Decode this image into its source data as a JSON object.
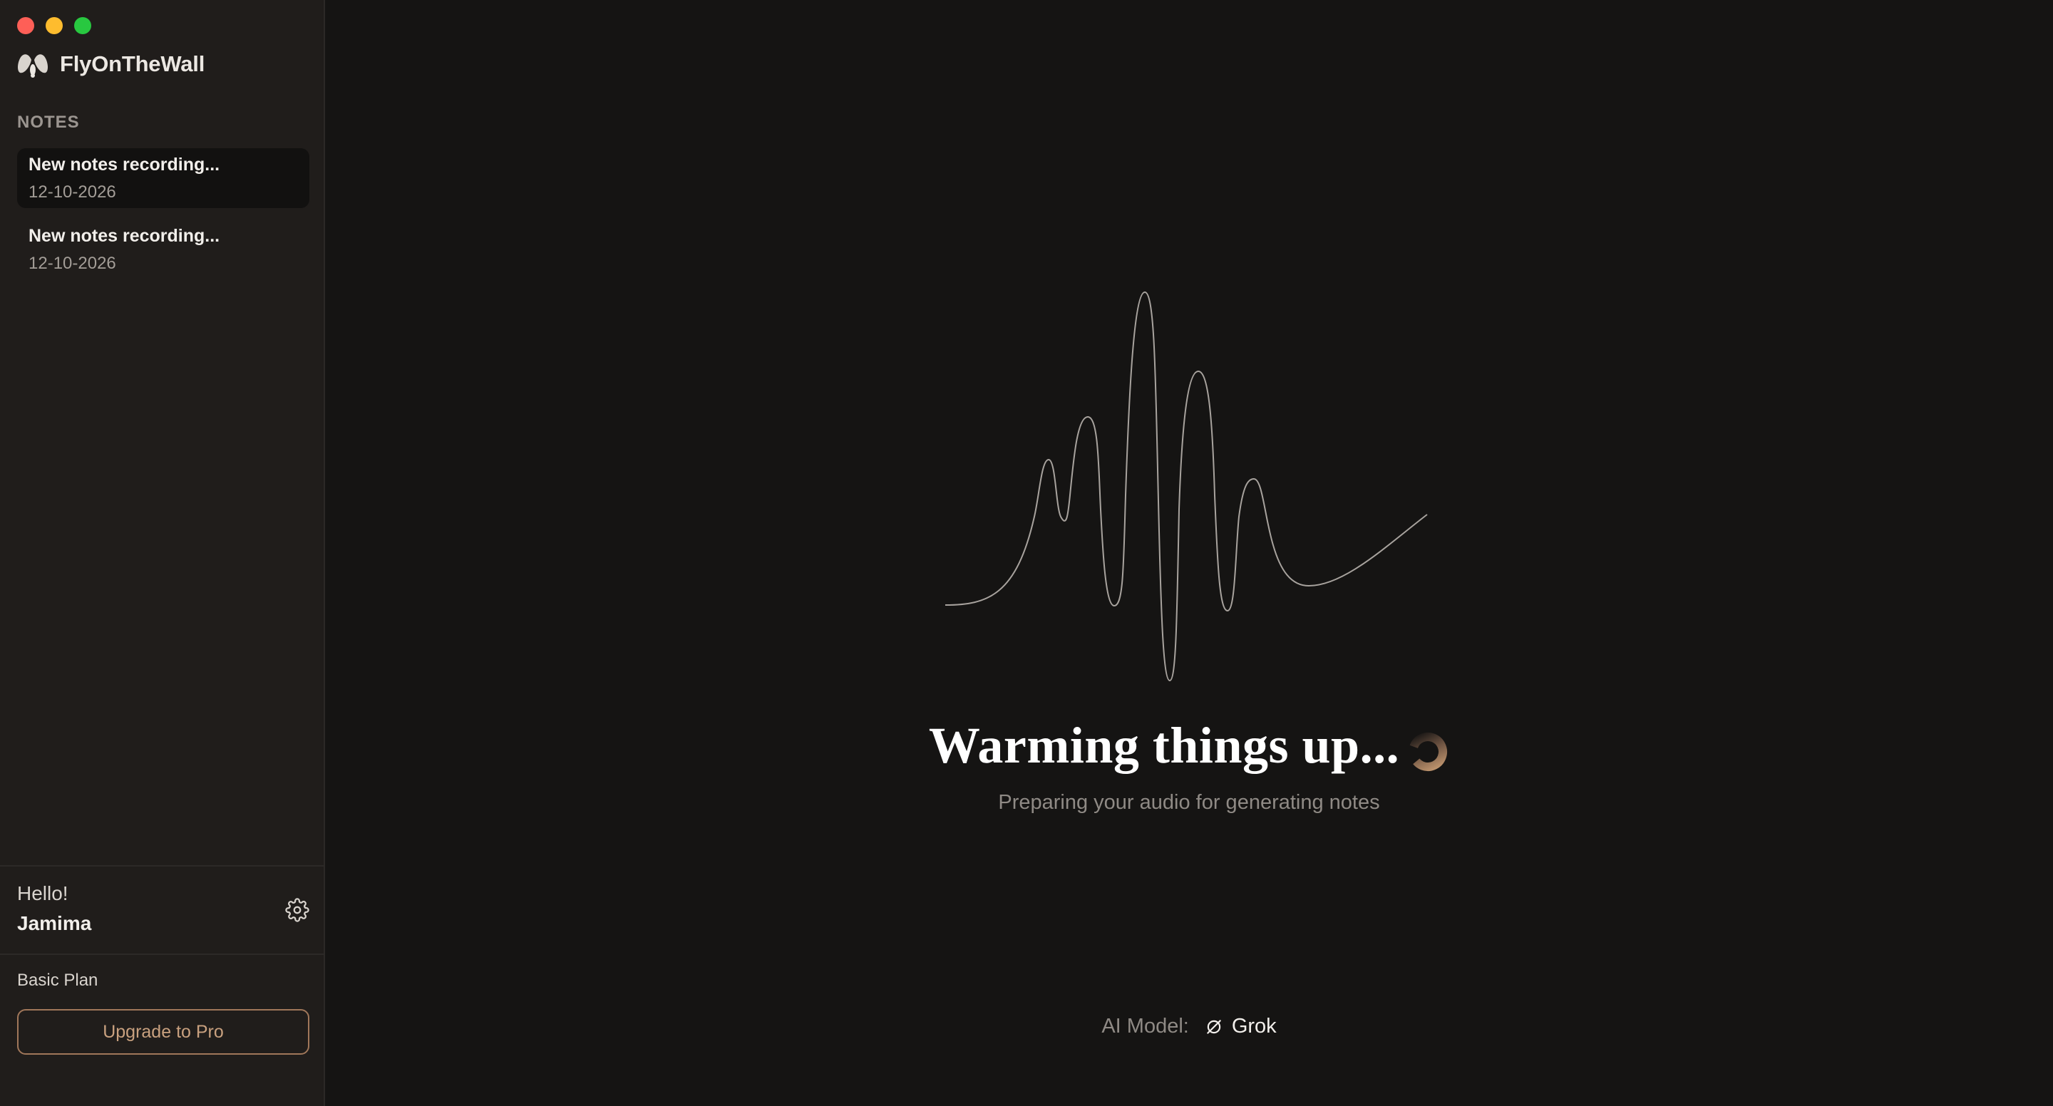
{
  "app": {
    "name": "FlyOnTheWall"
  },
  "window_controls": [
    {
      "name": "close-button"
    },
    {
      "name": "minimize-button"
    },
    {
      "name": "zoom-button"
    }
  ],
  "sidebar": {
    "section_label": "NOTES",
    "notes": [
      {
        "title": "New notes recording...",
        "date": "12-10-2026",
        "active": true
      },
      {
        "title": "New notes recording...",
        "date": "12-10-2026",
        "active": false
      }
    ],
    "user": {
      "greeting": "Hello!",
      "name": "Jamima",
      "settings_icon": "gear-icon"
    },
    "plan": {
      "label": "Basic Plan",
      "upgrade_label": "Upgrade to Pro"
    }
  },
  "main": {
    "heading": "Warming things up...",
    "subtext": "Preparing your audio for generating notes",
    "model": {
      "label": "AI Model:",
      "name": "Grok",
      "icon": "grok-icon"
    }
  },
  "colors": {
    "background": "#151413",
    "sidebar": "#201d1b",
    "accent": "#a0775a",
    "active_note": "#121110"
  }
}
